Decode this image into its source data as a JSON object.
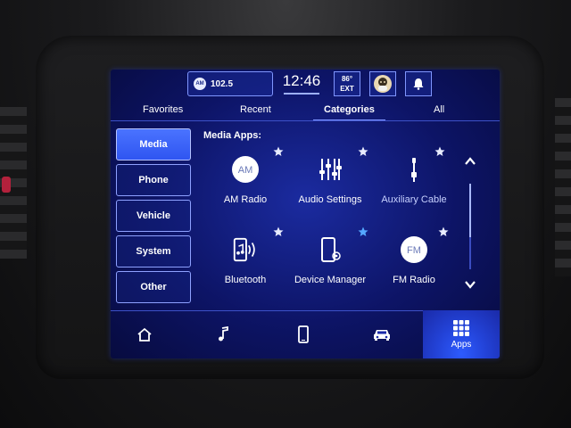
{
  "status_bar": {
    "radio_badge": "AM",
    "radio_station": "102.5",
    "time": "12:46",
    "temperature": "86°",
    "temperature_label": "EXT"
  },
  "tabs": [
    {
      "label": "Favorites",
      "active": false
    },
    {
      "label": "Recent",
      "active": false
    },
    {
      "label": "Categories",
      "active": true
    },
    {
      "label": "All",
      "active": false
    }
  ],
  "sidebar": {
    "items": [
      {
        "label": "Media",
        "active": true
      },
      {
        "label": "Phone",
        "active": false
      },
      {
        "label": "Vehicle",
        "active": false
      },
      {
        "label": "System",
        "active": false
      },
      {
        "label": "Other",
        "active": false
      }
    ]
  },
  "main": {
    "section_title": "Media Apps:",
    "apps": [
      {
        "label": "AM Radio",
        "icon": "am-radio-icon",
        "icon_text": "AM",
        "favorite": false
      },
      {
        "label": "Audio Settings",
        "icon": "audio-settings-icon",
        "favorite": false
      },
      {
        "label": "Auxiliary Cable",
        "icon": "auxiliary-cable-icon",
        "favorite": false,
        "dim": true
      },
      {
        "label": "Bluetooth",
        "icon": "bluetooth-audio-icon",
        "favorite": false
      },
      {
        "label": "Device Manager",
        "icon": "device-manager-icon",
        "favorite": true
      },
      {
        "label": "FM Radio",
        "icon": "fm-radio-icon",
        "icon_text": "FM",
        "favorite": false
      }
    ]
  },
  "bottom_nav": {
    "items": [
      {
        "icon": "home-icon"
      },
      {
        "icon": "music-note-icon"
      },
      {
        "icon": "phone-icon"
      },
      {
        "icon": "car-icon"
      },
      {
        "icon": "apps-grid-icon",
        "label": "Apps",
        "active": true
      }
    ]
  },
  "colors": {
    "screen_background": "#0d1466",
    "accent": "#2f55f1",
    "border": "#8ea1ff"
  }
}
